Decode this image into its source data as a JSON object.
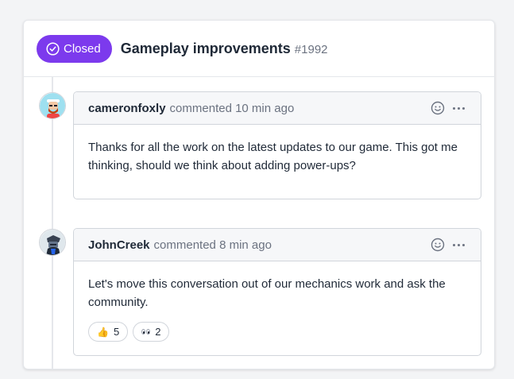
{
  "issue": {
    "status_label": "Closed",
    "title": "Gameplay improvements",
    "number": "#1992",
    "status_color": "#7c3aed"
  },
  "comments": [
    {
      "author": "cameronfoxly",
      "meta": "commented 10 min ago",
      "body": "Thanks for all the work on the latest updates to our game. This got me thinking, should we think about adding power-ups?",
      "avatar_icon": "bearded-man-avatar"
    },
    {
      "author": "JohnCreek",
      "meta": "commented 8 min ago",
      "body": "Let's move this conversation out of our mechanics work and ask the community.",
      "avatar_icon": "knight-avatar",
      "reactions": [
        {
          "emoji": "👍",
          "count": "5",
          "icon": "thumbs-up-icon"
        },
        {
          "emoji": "👀",
          "count": "2",
          "icon": "eyes-icon"
        }
      ]
    }
  ]
}
